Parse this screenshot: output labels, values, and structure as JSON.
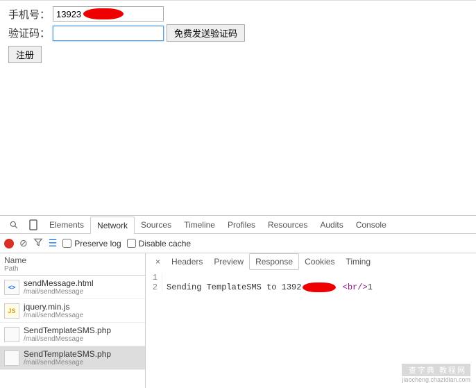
{
  "form": {
    "phone_label": "手机号：",
    "phone_value": "13923",
    "code_label": "验证码：",
    "code_value": "",
    "send_label": "免费发送验证码",
    "register_label": "注册"
  },
  "devtools": {
    "tabs": [
      "Elements",
      "Network",
      "Sources",
      "Timeline",
      "Profiles",
      "Resources",
      "Audits",
      "Console"
    ],
    "active_tab": "Network",
    "toolbar": {
      "preserve_label": "Preserve log",
      "disable_cache_label": "Disable cache"
    },
    "sidebar": {
      "header_name": "Name",
      "header_path": "Path",
      "requests": [
        {
          "icon": "<>",
          "type": "html",
          "name": "sendMessage.html",
          "path": "/mail/sendMessage",
          "selected": false
        },
        {
          "icon": "JS",
          "type": "js",
          "name": "jquery.min.js",
          "path": "/mail/sendMessage",
          "selected": false
        },
        {
          "icon": "",
          "type": "other",
          "name": "SendTemplateSMS.php",
          "path": "/mail/sendMessage",
          "selected": false
        },
        {
          "icon": "",
          "type": "other",
          "name": "SendTemplateSMS.php",
          "path": "/mail/sendMessage",
          "selected": true
        }
      ]
    },
    "detail": {
      "tabs": [
        "Headers",
        "Preview",
        "Response",
        "Cookies",
        "Timing"
      ],
      "active_tab": "Response",
      "response": {
        "line1": "",
        "line2_prefix": "Sending TemplateSMS to 1392",
        "line2_tag": "<br/>",
        "line2_suffix": "1"
      }
    }
  },
  "watermark": {
    "brand": "查字典 教程网",
    "url": "jiaocheng.chazidian.com"
  }
}
